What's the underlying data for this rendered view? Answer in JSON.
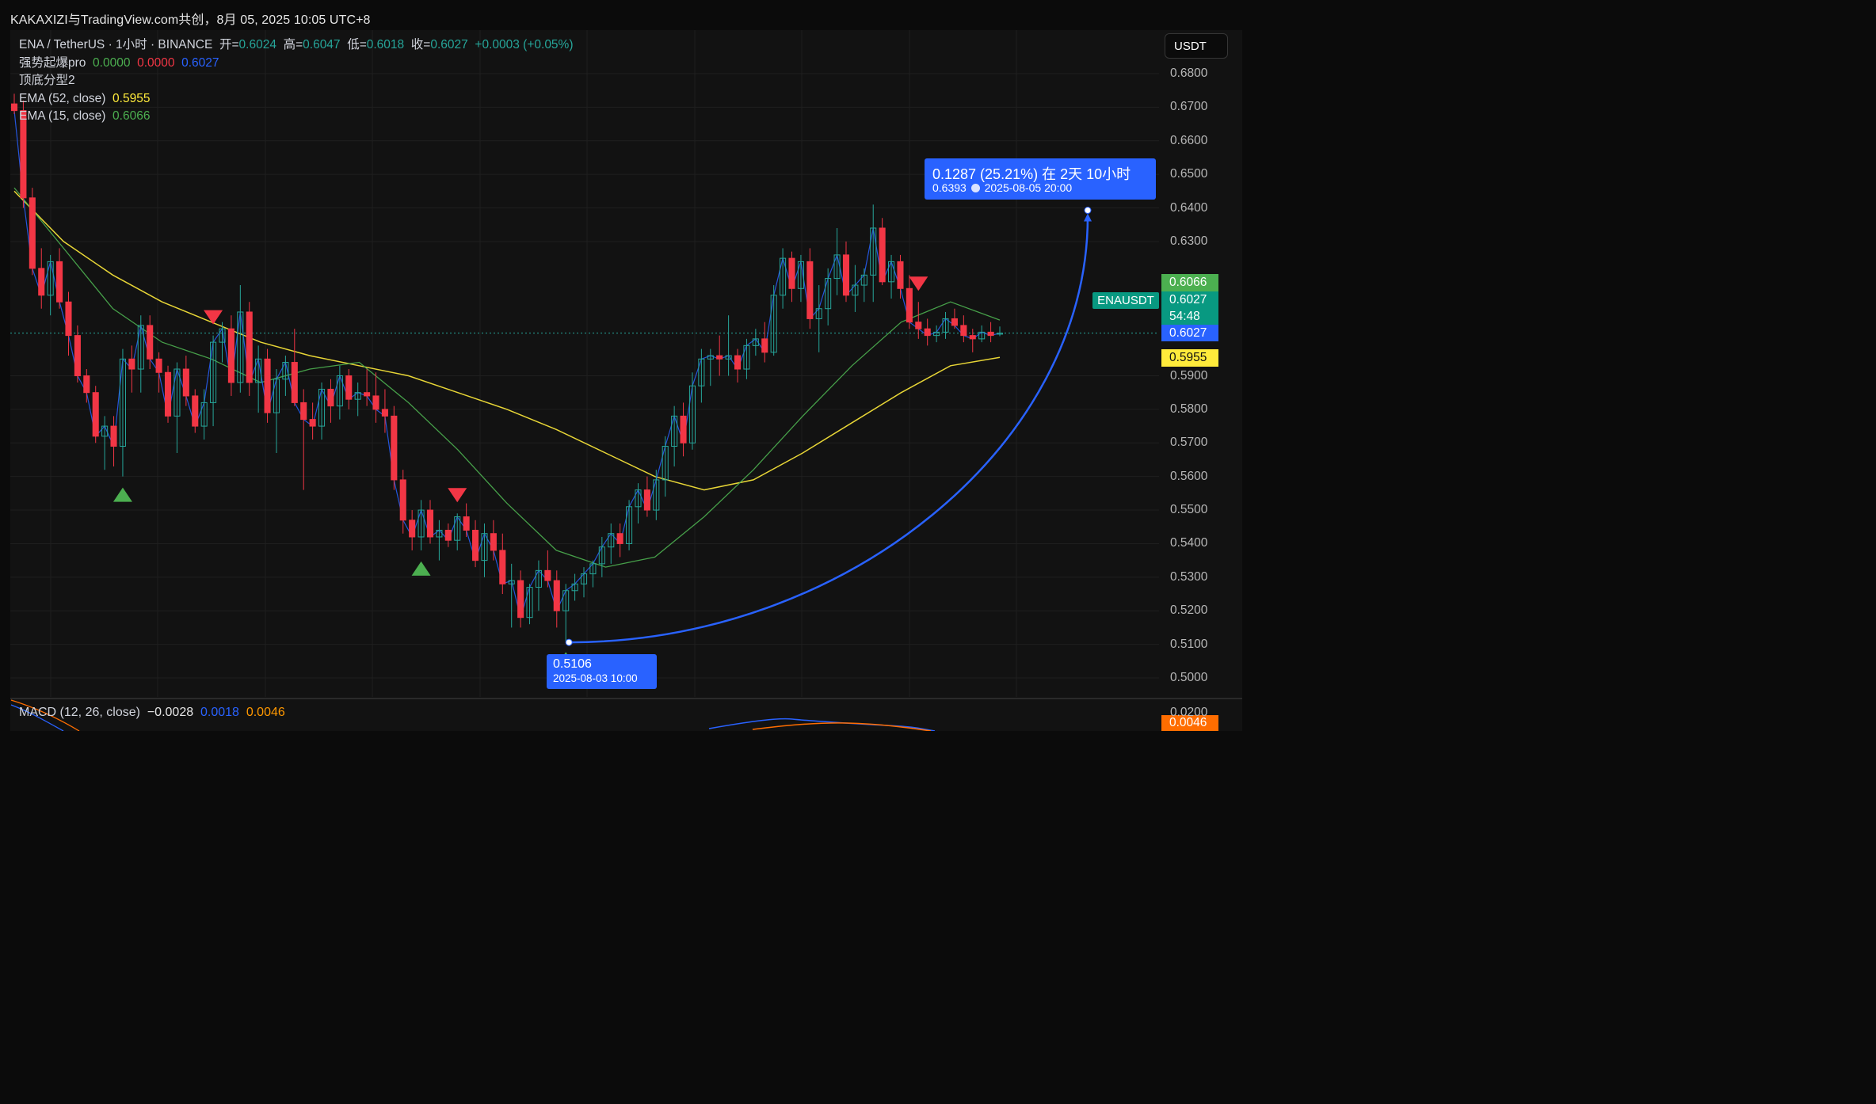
{
  "header": {
    "title": "KAKAXIZI与TradingView.com共创，8月 05, 2025 10:05 UTC+8"
  },
  "legend": {
    "symbol": "ENA / TetherUS · 1小时 · BINANCE",
    "open_label": "开=",
    "open": "0.6024",
    "high_label": "高=",
    "high": "0.6047",
    "low_label": "低=",
    "low": "0.6018",
    "close_label": "收=",
    "close": "0.6027",
    "change": "+0.0003 (+0.05%)",
    "ind1_name": "强势起爆pro",
    "ind1_v1": "0.0000",
    "ind1_v2": "0.0000",
    "ind1_v3": "0.6027",
    "ind2_name": "顶底分型2",
    "ema52_name": "EMA (52, close)",
    "ema52_value": "0.5955",
    "ema15_name": "EMA (15, close)",
    "ema15_value": "0.6066"
  },
  "macd": {
    "name": "MACD (12, 26, close)",
    "v1": "−0.0028",
    "v2": "0.0018",
    "v3": "0.0046"
  },
  "currency": "USDT",
  "axis": {
    "ticks": [
      "0.6800",
      "0.6700",
      "0.6600",
      "0.6500",
      "0.6400",
      "0.6300",
      "0.5900",
      "0.5800",
      "0.5700",
      "0.5600",
      "0.5500",
      "0.5400",
      "0.5300",
      "0.5200",
      "0.5100",
      "0.5000"
    ],
    "macd_tick": "0.0200"
  },
  "price_tags": {
    "ema15": "0.6066",
    "close_price": "0.6027",
    "countdown": "54:48",
    "last": "0.6027",
    "ema52": "0.5955",
    "macd_value": "0.0046",
    "symbol": "ENAUSDT"
  },
  "measure": {
    "line1": "0.1287 (25.21%) 在 2天 10小时",
    "price": "0.6393",
    "date": "2025-08-05  20:00"
  },
  "low_marker": {
    "price": "0.5106",
    "date": "2025-08-03 10:00"
  },
  "colors": {
    "background": "#121212",
    "up": "#26a69a",
    "down": "#f23645",
    "ema52": "#ffeb3b",
    "ema15": "#4caf50",
    "accent": "#2962ff"
  },
  "chart_data": {
    "type": "candlestick",
    "interval": "1h",
    "y_axis_range": [
      0.4975,
      0.6835
    ],
    "ohlc": [
      [
        0.671,
        0.674,
        0.668,
        0.669
      ],
      [
        0.669,
        0.672,
        0.64,
        0.643
      ],
      [
        0.643,
        0.646,
        0.62,
        0.622
      ],
      [
        0.622,
        0.628,
        0.61,
        0.614
      ],
      [
        0.614,
        0.626,
        0.608,
        0.624
      ],
      [
        0.624,
        0.628,
        0.61,
        0.612
      ],
      [
        0.612,
        0.615,
        0.596,
        0.602
      ],
      [
        0.602,
        0.605,
        0.588,
        0.59
      ],
      [
        0.59,
        0.592,
        0.582,
        0.585
      ],
      [
        0.585,
        0.587,
        0.57,
        0.572
      ],
      [
        0.572,
        0.578,
        0.562,
        0.575
      ],
      [
        0.575,
        0.578,
        0.563,
        0.569
      ],
      [
        0.569,
        0.598,
        0.56,
        0.595
      ],
      [
        0.595,
        0.599,
        0.585,
        0.592
      ],
      [
        0.592,
        0.608,
        0.585,
        0.605
      ],
      [
        0.605,
        0.608,
        0.592,
        0.595
      ],
      [
        0.595,
        0.597,
        0.585,
        0.591
      ],
      [
        0.591,
        0.593,
        0.576,
        0.578
      ],
      [
        0.578,
        0.594,
        0.567,
        0.592
      ],
      [
        0.592,
        0.596,
        0.581,
        0.584
      ],
      [
        0.584,
        0.586,
        0.573,
        0.575
      ],
      [
        0.575,
        0.586,
        0.571,
        0.582
      ],
      [
        0.582,
        0.602,
        0.575,
        0.6
      ],
      [
        0.6,
        0.606,
        0.594,
        0.604
      ],
      [
        0.604,
        0.608,
        0.584,
        0.588
      ],
      [
        0.588,
        0.617,
        0.585,
        0.609
      ],
      [
        0.609,
        0.612,
        0.584,
        0.588
      ],
      [
        0.588,
        0.599,
        0.579,
        0.595
      ],
      [
        0.595,
        0.598,
        0.576,
        0.579
      ],
      [
        0.579,
        0.592,
        0.567,
        0.589
      ],
      [
        0.589,
        0.596,
        0.584,
        0.594
      ],
      [
        0.594,
        0.604,
        0.581,
        0.582
      ],
      [
        0.582,
        0.586,
        0.556,
        0.577
      ],
      [
        0.577,
        0.582,
        0.571,
        0.575
      ],
      [
        0.575,
        0.588,
        0.571,
        0.586
      ],
      [
        0.586,
        0.589,
        0.576,
        0.581
      ],
      [
        0.581,
        0.593,
        0.577,
        0.59
      ],
      [
        0.59,
        0.592,
        0.58,
        0.583
      ],
      [
        0.583,
        0.588,
        0.578,
        0.585
      ],
      [
        0.585,
        0.592,
        0.581,
        0.584
      ],
      [
        0.584,
        0.591,
        0.576,
        0.58
      ],
      [
        0.58,
        0.586,
        0.573,
        0.578
      ],
      [
        0.578,
        0.581,
        0.556,
        0.559
      ],
      [
        0.559,
        0.562,
        0.543,
        0.547
      ],
      [
        0.547,
        0.55,
        0.538,
        0.542
      ],
      [
        0.542,
        0.553,
        0.538,
        0.55
      ],
      [
        0.55,
        0.553,
        0.54,
        0.542
      ],
      [
        0.542,
        0.547,
        0.535,
        0.544
      ],
      [
        0.544,
        0.546,
        0.539,
        0.541
      ],
      [
        0.541,
        0.549,
        0.538,
        0.548
      ],
      [
        0.548,
        0.552,
        0.542,
        0.544
      ],
      [
        0.544,
        0.547,
        0.533,
        0.535
      ],
      [
        0.535,
        0.546,
        0.53,
        0.543
      ],
      [
        0.543,
        0.547,
        0.535,
        0.538
      ],
      [
        0.538,
        0.543,
        0.525,
        0.528
      ],
      [
        0.528,
        0.534,
        0.515,
        0.529
      ],
      [
        0.529,
        0.532,
        0.515,
        0.518
      ],
      [
        0.518,
        0.528,
        0.516,
        0.527
      ],
      [
        0.527,
        0.535,
        0.52,
        0.532
      ],
      [
        0.532,
        0.538,
        0.527,
        0.529
      ],
      [
        0.529,
        0.532,
        0.515,
        0.52
      ],
      [
        0.52,
        0.528,
        0.511,
        0.526
      ],
      [
        0.526,
        0.531,
        0.523,
        0.528
      ],
      [
        0.528,
        0.533,
        0.524,
        0.531
      ],
      [
        0.531,
        0.535,
        0.527,
        0.534
      ],
      [
        0.534,
        0.542,
        0.53,
        0.539
      ],
      [
        0.539,
        0.546,
        0.534,
        0.543
      ],
      [
        0.543,
        0.546,
        0.536,
        0.54
      ],
      [
        0.54,
        0.553,
        0.538,
        0.551
      ],
      [
        0.551,
        0.558,
        0.546,
        0.556
      ],
      [
        0.556,
        0.56,
        0.548,
        0.55
      ],
      [
        0.55,
        0.562,
        0.547,
        0.559
      ],
      [
        0.559,
        0.572,
        0.554,
        0.569
      ],
      [
        0.569,
        0.581,
        0.563,
        0.578
      ],
      [
        0.578,
        0.582,
        0.566,
        0.57
      ],
      [
        0.57,
        0.591,
        0.568,
        0.587
      ],
      [
        0.587,
        0.598,
        0.582,
        0.595
      ],
      [
        0.595,
        0.598,
        0.587,
        0.596
      ],
      [
        0.596,
        0.602,
        0.59,
        0.595
      ],
      [
        0.595,
        0.608,
        0.59,
        0.596
      ],
      [
        0.596,
        0.598,
        0.588,
        0.592
      ],
      [
        0.592,
        0.601,
        0.589,
        0.599
      ],
      [
        0.599,
        0.604,
        0.596,
        0.601
      ],
      [
        0.601,
        0.606,
        0.594,
        0.597
      ],
      [
        0.597,
        0.617,
        0.596,
        0.614
      ],
      [
        0.614,
        0.628,
        0.61,
        0.625
      ],
      [
        0.625,
        0.627,
        0.612,
        0.616
      ],
      [
        0.616,
        0.626,
        0.612,
        0.624
      ],
      [
        0.624,
        0.628,
        0.604,
        0.607
      ],
      [
        0.607,
        0.617,
        0.597,
        0.61
      ],
      [
        0.61,
        0.622,
        0.605,
        0.619
      ],
      [
        0.619,
        0.634,
        0.614,
        0.626
      ],
      [
        0.626,
        0.63,
        0.612,
        0.614
      ],
      [
        0.614,
        0.623,
        0.609,
        0.617
      ],
      [
        0.617,
        0.622,
        0.612,
        0.62
      ],
      [
        0.62,
        0.641,
        0.612,
        0.634
      ],
      [
        0.634,
        0.637,
        0.617,
        0.618
      ],
      [
        0.618,
        0.626,
        0.613,
        0.624
      ],
      [
        0.624,
        0.626,
        0.613,
        0.616
      ],
      [
        0.616,
        0.62,
        0.604,
        0.606
      ],
      [
        0.606,
        0.612,
        0.601,
        0.604
      ],
      [
        0.604,
        0.607,
        0.599,
        0.602
      ],
      [
        0.602,
        0.605,
        0.6,
        0.603
      ],
      [
        0.603,
        0.609,
        0.601,
        0.607
      ],
      [
        0.607,
        0.61,
        0.604,
        0.605
      ],
      [
        0.605,
        0.608,
        0.6,
        0.602
      ],
      [
        0.602,
        0.604,
        0.597,
        0.601
      ],
      [
        0.601,
        0.605,
        0.6,
        0.603
      ],
      [
        0.603,
        0.606,
        0.6,
        0.602
      ],
      [
        0.6024,
        0.6047,
        0.6018,
        0.6027
      ]
    ],
    "ema_52": [
      0.645,
      0.63,
      0.62,
      0.612,
      0.606,
      0.6,
      0.596,
      0.593,
      0.59,
      0.585,
      0.58,
      0.574,
      0.567,
      0.56,
      0.556,
      0.559,
      0.567,
      0.576,
      0.585,
      0.593,
      0.5955
    ],
    "ema_15": [
      0.646,
      0.628,
      0.61,
      0.6,
      0.595,
      0.588,
      0.592,
      0.594,
      0.582,
      0.568,
      0.552,
      0.538,
      0.533,
      0.536,
      0.548,
      0.562,
      0.578,
      0.593,
      0.606,
      0.612,
      0.6066
    ],
    "signals_sell": [
      22,
      49,
      100
    ],
    "signals_buy": [
      12,
      45,
      61
    ],
    "y_ticks": [
      0.68,
      0.67,
      0.66,
      0.65,
      0.64,
      0.63,
      0.59,
      0.58,
      0.57,
      0.56,
      0.55,
      0.54,
      0.53,
      0.52,
      0.51,
      0.5
    ]
  }
}
